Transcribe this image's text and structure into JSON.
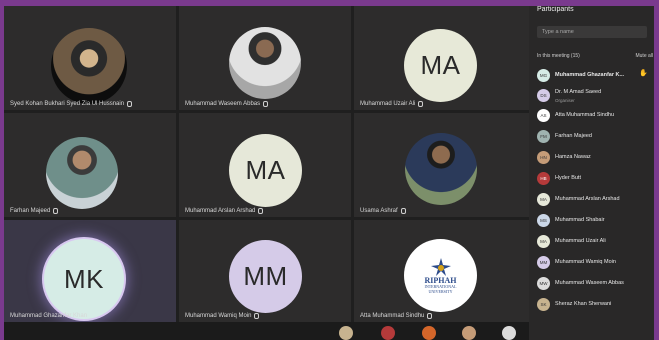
{
  "tiles": [
    {
      "name": "Syed Kohan Bukhari Syed Zia Ul Hussnain",
      "type": "photo"
    },
    {
      "name": "Muhammad Waseem Abbas",
      "type": "photo2"
    },
    {
      "name": "Muhammad Uzair Ali",
      "initials": "MA",
      "color": "#e7e9d8"
    },
    {
      "name": "Farhan Majeed",
      "type": "photo3"
    },
    {
      "name": "Muhammad Arslan Arshad",
      "initials": "MA",
      "color": "#e6e8d9"
    },
    {
      "name": "Usama Ashraf",
      "type": "photo4"
    },
    {
      "name": "Muhammad Ghazanfar Khan",
      "initials": "MK",
      "color": "#d6ece6"
    },
    {
      "name": "Muhammad Wamiq Moin",
      "initials": "MM",
      "color": "#d5cbe8"
    },
    {
      "name": "Atta Muhammad Sindhu",
      "type": "logo"
    }
  ],
  "logo": {
    "line1": "RIPHAH",
    "line2": "INTERNATIONAL",
    "line3": "UNIVERSITY"
  },
  "panel": {
    "title": "Participants",
    "search_placeholder": "Type a name",
    "meeting_label": "In this meeting (15)",
    "mute_all": "Mute all",
    "participants": [
      {
        "name": "Muhammad Ghazanfar K...",
        "initials": "MG",
        "color": "#d6ece6",
        "hand": "✋",
        "bold": true
      },
      {
        "name": "Dr. M Amad Saeed",
        "initials": "DS",
        "color": "#d5cbe8",
        "org": "Organiser"
      },
      {
        "name": "Atta Muhammad Sindhu",
        "initials": "AS",
        "color": "#ffffff"
      },
      {
        "name": "Farhan Majeed",
        "initials": "FM",
        "color": "#9fb3b0"
      },
      {
        "name": "Hamza Nawaz",
        "initials": "HN",
        "color": "#c59c78"
      },
      {
        "name": "Hyder Butt",
        "initials": "HB",
        "color": "#b53a3a"
      },
      {
        "name": "Muhammad Arslan Arshad",
        "initials": "MA",
        "color": "#e6e8d9"
      },
      {
        "name": "Muhammad Shabair",
        "initials": "MS",
        "color": "#cbd7e8"
      },
      {
        "name": "Muhammad Uzair Ali",
        "initials": "MA",
        "color": "#e7e9d8"
      },
      {
        "name": "Muhammad Wamiq Moin",
        "initials": "MM",
        "color": "#d5cbe8"
      },
      {
        "name": "Muhammad Waseem Abbas",
        "initials": "MW",
        "color": "#dcdcdc"
      },
      {
        "name": "Sheraz Khan Sherwani",
        "initials": "SK",
        "color": "#c7b38f"
      }
    ]
  }
}
